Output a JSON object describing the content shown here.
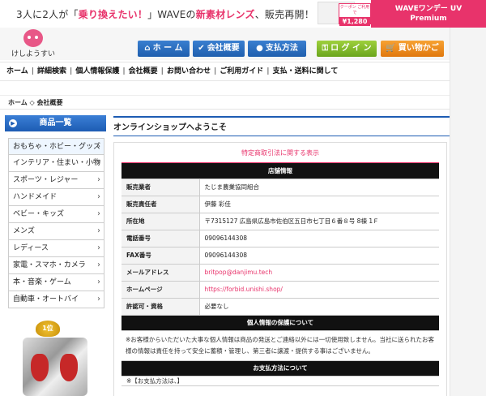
{
  "banner": {
    "text_a": "3人に2人が「",
    "text_b": "乗り換えたい！",
    "text_c": "」WAVEの",
    "text_d": "新素材レンズ",
    "text_e": "、販売再開！",
    "coupon_label": "クーポン ご利用で",
    "coupon_price": "¥1,280",
    "wave_line1": "WAVEワンデー UV",
    "wave_line2": "Premium"
  },
  "header": {
    "logo_text": "けしようすい",
    "buttons": {
      "home": "ホ ー ム",
      "company": "会社概要",
      "payment": "支払方法",
      "login": "ロ グ イ ン",
      "cart": "買い物かご"
    }
  },
  "nav": {
    "items": [
      "ホーム",
      "詳細検索",
      "個人情報保護",
      "会社概要",
      "お問い合わせ",
      "ご利用ガイド",
      "支払・送料に関して"
    ]
  },
  "breadcrumb": "ホーム ◇ 会社概要",
  "sidebar": {
    "title": "商品一覧",
    "items": [
      "おもちゃ・ホビー・グッズ",
      "インテリア・住まい・小物",
      "スポーツ・レジャー",
      "ハンドメイド",
      "ベビー・キッズ",
      "メンズ",
      "レディース",
      "家電・スマホ・カメラ",
      "本・音楽・ゲーム",
      "自動車・オートバイ"
    ],
    "rank_label": "1位"
  },
  "main": {
    "title": "オンラインショップへようこそ",
    "caption": "特定商取引法に関する表示",
    "store_info_header": "店舗情報",
    "rows": [
      {
        "k": "販売業者",
        "v": "たじま農業協同組合"
      },
      {
        "k": "販売責任者",
        "v": "伊藤 彩佳"
      },
      {
        "k": "所在地",
        "v": "〒7315127 広島県広島市佐伯区五日市七丁目６番８号 8棟 1Ｆ"
      },
      {
        "k": "電話番号",
        "v": "09096144308"
      },
      {
        "k": "FAX番号",
        "v": "09096144308"
      },
      {
        "k": "メールアドレス",
        "v": "britpop@danjimu.tech"
      },
      {
        "k": "ホームページ",
        "v": "https://forbid.unishi.shop/"
      },
      {
        "k": "許認可・資格",
        "v": "必要なし"
      }
    ],
    "privacy_header": "個人情報の保護について",
    "privacy_text": "※お客様からいただいた大事な個人情報は商品の発送とご連絡以外には一切使用致しません。当社に送られたお客様の情報は責任を持って安全に蓄積・管理し、第三者に譲渡・提供する事はございません。",
    "payment_header": "お支払方法について",
    "payment_text": "※【お支払方法は、】"
  }
}
